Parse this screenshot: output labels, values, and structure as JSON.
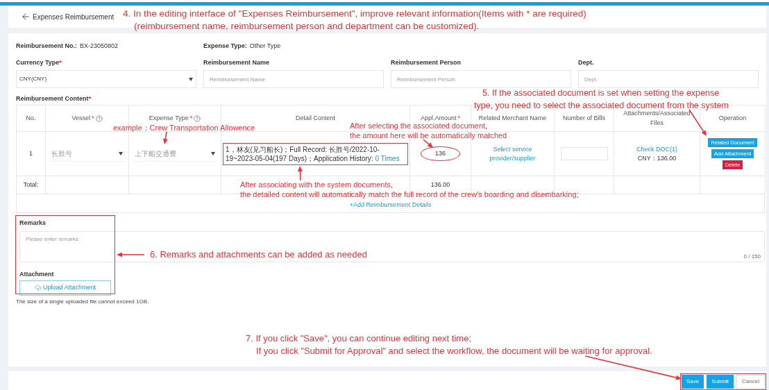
{
  "header": {
    "title": "Expenses Reimbursement"
  },
  "info": [
    {
      "label": "Reimbursement No.:",
      "value": "BX-23050802"
    },
    {
      "label": "Expense Type:",
      "value": "Other Type"
    }
  ],
  "fields": [
    {
      "label": "Currency Type",
      "mark": "*",
      "kind": "select",
      "value": "CNY(CNY)"
    },
    {
      "label": "Reimbursement Name",
      "kind": "input",
      "placeholder": "Reimbursement Name"
    },
    {
      "label": "Reimbursement Person",
      "kind": "input",
      "placeholder": "Reimbursement Person"
    },
    {
      "label": "Dept.",
      "kind": "input",
      "placeholder": "Dept."
    }
  ],
  "content": {
    "label": "Reimbursement Content",
    "mark": "*",
    "columns": [
      {
        "label": "No."
      },
      {
        "label": "Vessel",
        "mark": "*",
        "help": true
      },
      {
        "label": "Expense Type",
        "mark": "*",
        "help": true
      },
      {
        "label": "Detail Content"
      },
      {
        "label": "Appl.Amount",
        "mark": "*"
      },
      {
        "label": "Related Merchant Name"
      },
      {
        "label": "Number of Bills"
      },
      {
        "label": "Attachments/Associated Files"
      },
      {
        "label": "Operation"
      }
    ],
    "rows": [
      {
        "no": "1",
        "vessel": "长胜号",
        "expense_type": "上下船交通费",
        "detail": "1，林友(见习船长)；Full Record: 长胜号/2022-10-19~2023-05-04(197 Days)；Application History: ",
        "detail_link": "0 Times",
        "amount": "136",
        "merchant_link": "Select service provider/supplier",
        "attachment_link": "Check DOC(1)",
        "attachment_amount": "CNY：136.00",
        "operations": [
          {
            "label": "Related Document",
            "kind": "primary"
          },
          {
            "label": "Add Attachment",
            "kind": "primary"
          },
          {
            "label": "Delete",
            "kind": "danger"
          }
        ]
      }
    ],
    "total": {
      "label": "Total:",
      "amount": "136.00"
    },
    "add_link": "+Add Reimbursement Details"
  },
  "remarks": {
    "label": "Remarks",
    "placeholder": "Please enter remarks",
    "counter": "0 / 150"
  },
  "attachment": {
    "label": "Attachment",
    "button": "Upload Attachment",
    "note": "The size of a single uploaded file cannot exceed 1GB."
  },
  "footer_buttons": [
    {
      "label": "Save",
      "kind": "primary"
    },
    {
      "label": "Submit",
      "kind": "primary"
    },
    {
      "label": "Cancel",
      "kind": "default"
    }
  ],
  "annotations": [
    {
      "lines": [
        "4. In the editing interface of \"Expenses Reimbursement\", improve relevant information(Items with * are required)",
        "(reimbursement name, reimbursement person and department can be customized)."
      ]
    },
    {
      "lines": [
        "5. If the associated document is set when setting the expense",
        "type, you need to select the associated document from the system"
      ]
    },
    {
      "lines": [
        "example：Crew Transportation Allowence"
      ]
    },
    {
      "lines": [
        "After selecting the associated document,",
        "the amount here will be automatically matched"
      ]
    },
    {
      "lines": [
        "After associating with the system documents,",
        "the detailed content will automatically match the full record of the crew's boarding and disembarking;"
      ]
    },
    {
      "lines": [
        "6. Remarks and attachments can be added as needed"
      ]
    },
    {
      "lines": [
        "7. If you click \"Save\", you can continue editing next time;",
        "If you click \"Submit for Approval\" and select the workflow, the document will be waiting for approval."
      ]
    }
  ]
}
